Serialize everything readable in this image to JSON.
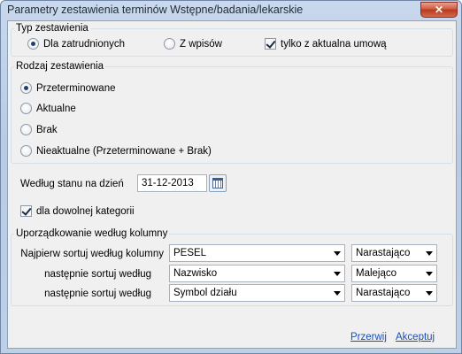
{
  "window": {
    "title": "Parametry zestawienia terminów Wstępne/badania/lekarskie",
    "close_glyph": "✕"
  },
  "typ": {
    "legend": "Typ zestawienia",
    "options": [
      {
        "label": "Dla zatrudnionych",
        "selected": true
      },
      {
        "label": "Z wpisów",
        "selected": false
      }
    ],
    "checkbox_label": "tylko z aktualna umową",
    "checkbox_checked": true
  },
  "rodzaj": {
    "legend": "Rodzaj zestawienia",
    "options": [
      {
        "label": "Przeterminowane",
        "selected": true
      },
      {
        "label": "Aktualne",
        "selected": false
      },
      {
        "label": "Brak",
        "selected": false
      },
      {
        "label": "Nieaktualne (Przeterminowane + Brak)",
        "selected": false
      }
    ]
  },
  "stan": {
    "label": "Według stanu na dzień",
    "date_value": "31-12-2013"
  },
  "kategoria": {
    "label": "dla dowolnej kategorii",
    "checked": true
  },
  "sort": {
    "legend": "Uporządkowanie według kolumny",
    "rows": [
      {
        "label": "Najpierw sortuj według kolumny",
        "column": "PESEL",
        "order": "Narastająco"
      },
      {
        "label": "następnie sortuj według",
        "column": "Nazwisko",
        "order": "Malejąco"
      },
      {
        "label": "następnie sortuj według",
        "column": "Symbol działu",
        "order": "Narastająco"
      }
    ]
  },
  "actions": {
    "cancel": "Przerwij",
    "accept": "Akceptuj"
  }
}
